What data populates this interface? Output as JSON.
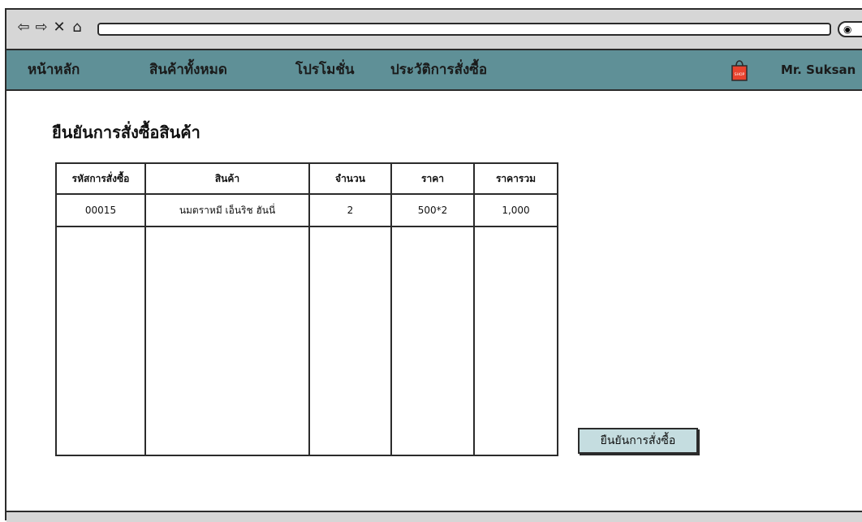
{
  "browser": {
    "back_icon": "back-arrow-icon",
    "forward_icon": "forward-arrow-icon",
    "close_icon": "close-icon",
    "home_icon": "home-icon",
    "url": ""
  },
  "menu": {
    "items": [
      {
        "label": "หน้าหลัก"
      },
      {
        "label": "สินค้าทั้งหมด"
      },
      {
        "label": "โปรโมชั่น"
      },
      {
        "label": "ประวัติการสั่งซื้อ"
      }
    ],
    "shop_icon_text": "SHOP",
    "user_name": "Mr. Suksan"
  },
  "page": {
    "title": "ยืนยันการสั่งซื้อสินค้า"
  },
  "table": {
    "headers": [
      "รหัสการสั่งซื้อ",
      "สินค้า",
      "จำนวน",
      "ราคา",
      "ราคารวม"
    ],
    "rows": [
      [
        "00015",
        "นมตราหมี เอ็นริช ฮันนี่",
        "2",
        "500*2",
        "1,000"
      ]
    ]
  },
  "actions": {
    "confirm_label": "ยืนยันการสั่งซื้อ"
  },
  "colors": {
    "menu_bar": "#5f9097",
    "browser_chrome": "#d6d6d6",
    "button_bg": "#c5dde0",
    "shop_bag": "#e8432e"
  }
}
